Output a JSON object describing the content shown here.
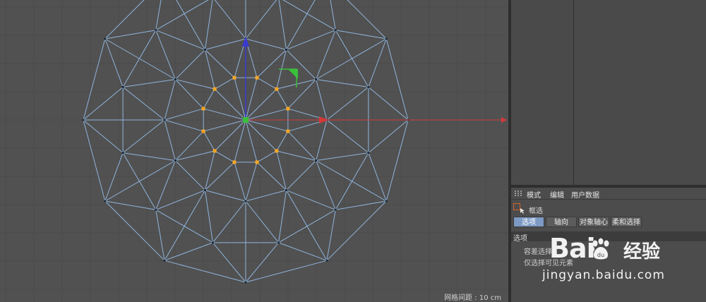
{
  "viewport": {
    "grid_spacing_label": "网格间距 : 10 cm"
  },
  "attributes": {
    "menu": [
      "模式",
      "编辑",
      "用户数据"
    ],
    "tool_name": "框选",
    "tabs": [
      {
        "label": "选项",
        "active": true
      },
      {
        "label": "轴向",
        "active": false
      },
      {
        "label": "对象轴心",
        "active": false
      },
      {
        "label": "柔和选择",
        "active": false
      }
    ],
    "section_title": "选项",
    "options": [
      "容差选择",
      "仅选择可见元素"
    ]
  },
  "watermark": {
    "logo_text": "Bai",
    "logo_suffix": "经验",
    "url": "jingyan.baidu.com"
  },
  "colors": {
    "wire": "#8fb4dc",
    "point_selected": "#f5a623",
    "axis_x": "#d43a3a",
    "axis_y": "#3a3ad4",
    "axis_z": "#3bbf3b"
  }
}
